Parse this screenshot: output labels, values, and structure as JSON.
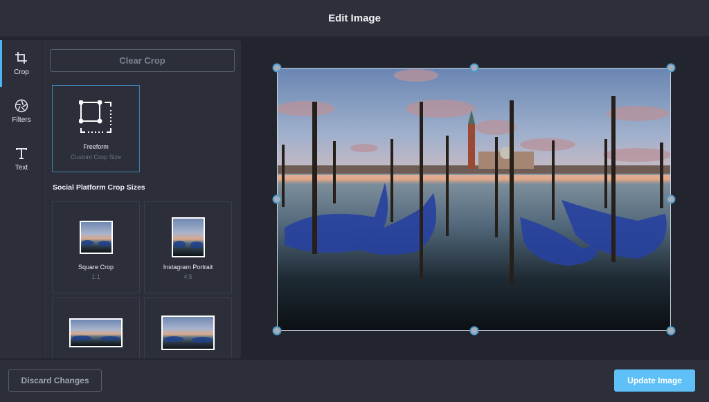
{
  "header": {
    "title": "Edit Image"
  },
  "tools": [
    {
      "label": "Crop",
      "icon": "crop-icon",
      "active": true
    },
    {
      "label": "Filters",
      "icon": "aperture-icon",
      "active": false
    },
    {
      "label": "Text",
      "icon": "text-icon",
      "active": false
    }
  ],
  "panel": {
    "clear_crop_label": "Clear Crop",
    "freeform": {
      "name": "Freeform",
      "subtitle": "Custom Crop Size",
      "selected": true
    },
    "section_title": "Social Platform Crop Sizes",
    "crop_sizes": [
      {
        "name": "Square Crop",
        "ratio": "1:1"
      },
      {
        "name": "Instagram Portrait",
        "ratio": "4:5"
      },
      {
        "name": "",
        "ratio": ""
      },
      {
        "name": "",
        "ratio": ""
      }
    ]
  },
  "canvas": {
    "image_alt": "Gondolas moored at sunset in Venice with San Giorgio Maggiore in the background",
    "accent_color": "#4d9acb"
  },
  "footer": {
    "discard_label": "Discard Changes",
    "update_label": "Update Image",
    "update_color": "#5ec0f7"
  }
}
